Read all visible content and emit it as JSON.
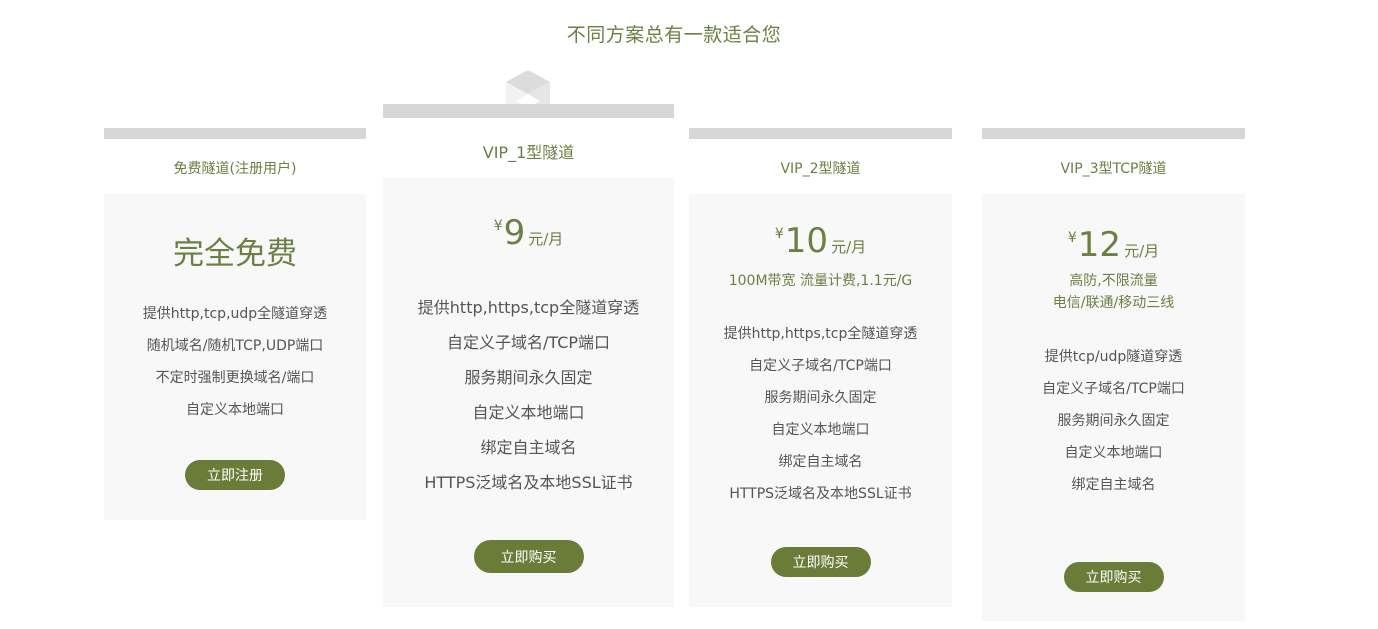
{
  "page": {
    "heading": "不同方案总有一款适合您"
  },
  "plans": [
    {
      "name": "免费隧道(注册用户)",
      "headline": "完全免费",
      "features": [
        "提供http,tcp,udp全隧道穿透",
        "随机域名/随机TCP,UDP端口",
        "不定时强制更换域名/端口",
        "自定义本地端口"
      ],
      "button": "立即注册"
    },
    {
      "name": "VIP_1型隧道",
      "price": {
        "currency": "¥",
        "amount": "9",
        "unit": "元/月"
      },
      "features": [
        "提供http,https,tcp全隧道穿透",
        "自定义子域名/TCP端口",
        "服务期间永久固定",
        "自定义本地端口",
        "绑定自主域名",
        "HTTPS泛域名及本地SSL证书"
      ],
      "button": "立即购买"
    },
    {
      "name": "VIP_2型隧道",
      "price": {
        "currency": "¥",
        "amount": "10",
        "unit": "元/月"
      },
      "note": "100M带宽 流量计费,1.1元/G",
      "features": [
        "提供http,https,tcp全隧道穿透",
        "自定义子域名/TCP端口",
        "服务期间永久固定",
        "自定义本地端口",
        "绑定自主域名",
        "HTTPS泛域名及本地SSL证书"
      ],
      "button": "立即购买"
    },
    {
      "name": "VIP_3型TCP隧道",
      "price": {
        "currency": "¥",
        "amount": "12",
        "unit": "元/月"
      },
      "note_lines": [
        "高防,不限流量",
        "电信/联通/移动三线"
      ],
      "features": [
        "提供tcp/udp隧道穿透",
        "自定义子域名/TCP端口",
        "服务期间永久固定",
        "自定义本地端口",
        "绑定自主域名"
      ],
      "button": "立即购买"
    }
  ],
  "colors": {
    "accent": "#6b8043",
    "button": "#6b7c38",
    "card_bg": "#f8f8f8",
    "bar": "#d7d7d7"
  },
  "icons": {
    "featured_badge": "cube-icon"
  }
}
